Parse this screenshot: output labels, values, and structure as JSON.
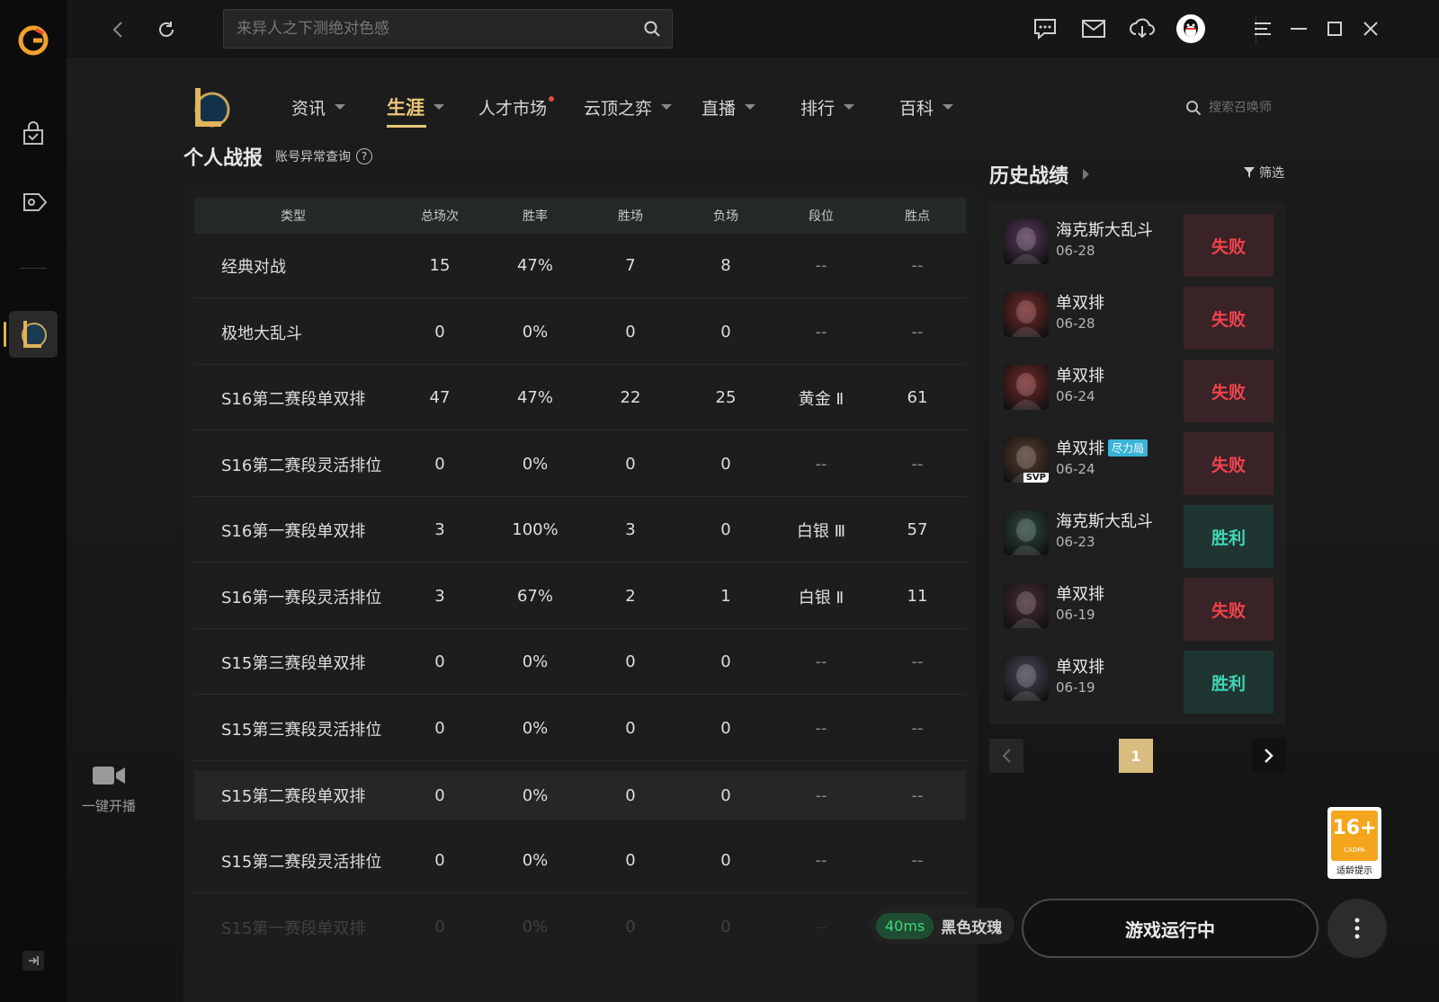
{
  "search": {
    "placeholder": "来异人之下测绝对色感"
  },
  "nav": [
    {
      "label": "资讯",
      "caret": true
    },
    {
      "label": "生涯",
      "caret": true,
      "active": true
    },
    {
      "label": "人才市场",
      "dot": true
    },
    {
      "label": "云顶之弈",
      "caret": true
    },
    {
      "label": "直播",
      "caret": true
    },
    {
      "label": "排行",
      "caret": true
    },
    {
      "label": "百科",
      "caret": true
    }
  ],
  "summoner_search": {
    "placeholder": "搜索召唤师"
  },
  "record": {
    "title": "个人战报",
    "link": "账号异常查询",
    "help": "?",
    "headers": [
      "类型",
      "总场次",
      "胜率",
      "胜场",
      "负场",
      "段位",
      "胜点"
    ],
    "rows": [
      [
        "经典对战",
        "15",
        "47%",
        "7",
        "8",
        "--",
        "--"
      ],
      [
        "极地大乱斗",
        "0",
        "0%",
        "0",
        "0",
        "--",
        "--"
      ],
      [
        "S16第二赛段单双排",
        "47",
        "47%",
        "22",
        "25",
        "黄金 Ⅱ",
        "61"
      ],
      [
        "S16第二赛段灵活排位",
        "0",
        "0%",
        "0",
        "0",
        "--",
        "--"
      ],
      [
        "S16第一赛段单双排",
        "3",
        "100%",
        "3",
        "0",
        "白银 Ⅲ",
        "57"
      ],
      [
        "S16第一赛段灵活排位",
        "3",
        "67%",
        "2",
        "1",
        "白银 Ⅱ",
        "11"
      ],
      [
        "S15第三赛段单双排",
        "0",
        "0%",
        "0",
        "0",
        "--",
        "--"
      ],
      [
        "S15第三赛段灵活排位",
        "0",
        "0%",
        "0",
        "0",
        "--",
        "--"
      ],
      [
        "S15第二赛段单双排",
        "0",
        "0%",
        "0",
        "0",
        "--",
        "--"
      ],
      [
        "S15第二赛段灵活排位",
        "0",
        "0%",
        "0",
        "0",
        "--",
        "--"
      ],
      [
        "S15第一赛段单双排",
        "0",
        "0%",
        "0",
        "0",
        "--",
        "--"
      ]
    ]
  },
  "history": {
    "title": "历史战绩",
    "filter": "筛选",
    "matches": [
      {
        "mode": "海克斯大乱斗",
        "date": "06-28",
        "result": "失败",
        "win": false,
        "color": "#5a3a5e"
      },
      {
        "mode": "单双排",
        "date": "06-28",
        "result": "失败",
        "win": false,
        "color": "#7a2a2a"
      },
      {
        "mode": "单双排",
        "date": "06-24",
        "result": "失败",
        "win": false,
        "color": "#7a2a2a"
      },
      {
        "mode": "单双排",
        "date": "06-24",
        "result": "失败",
        "win": false,
        "tag": "尽力局",
        "badge": "SVP",
        "color": "#5a4030"
      },
      {
        "mode": "海克斯大乱斗",
        "date": "06-23",
        "result": "胜利",
        "win": true,
        "color": "#2e4a44"
      },
      {
        "mode": "单双排",
        "date": "06-19",
        "result": "失败",
        "win": false,
        "color": "#4a2e38"
      },
      {
        "mode": "单双排",
        "date": "06-19",
        "result": "胜利",
        "win": true,
        "color": "#4a4a5a"
      }
    ],
    "page": "1"
  },
  "broadcast": {
    "label": "一键开播"
  },
  "ping": {
    "ms": "40ms",
    "server": "黑色玫瑰"
  },
  "run_button": "游戏运行中",
  "age_rating": {
    "rating": "16+",
    "org": "CADPA",
    "label": "适龄提示"
  },
  "colors": {
    "accent": "#e8c777",
    "lose": "#f0434f",
    "win": "#3fd6b8"
  }
}
